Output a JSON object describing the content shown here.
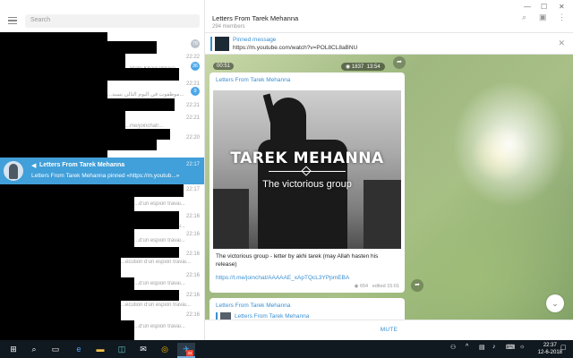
{
  "sidebar": {
    "search_placeholder": "Search",
    "rows": [
      {
        "time": "",
        "preview": "...",
        "badge": "78",
        "badge_color": "gray"
      },
      {
        "time": "22:22",
        "preview": "...",
        "badge": "36",
        "badge_color": "blue"
      },
      {
        "time": "22:21",
        "preview": "...State Khayr Wilaya...",
        "badge": "",
        "badge_color": ""
      },
      {
        "time": "22:21",
        "preview": "...",
        "badge": "9",
        "badge_color": "blue"
      },
      {
        "time": "22:21",
        "preview": "...موظفوت في اليوم التالي بسبد...",
        "badge": "",
        "badge_color": ""
      },
      {
        "time": "22:21",
        "preview": "...me/joinchat/...",
        "badge": "",
        "badge_color": ""
      },
      {
        "time": "22:20",
        "preview": "...",
        "badge": "",
        "badge_color": ""
      }
    ],
    "active_chat": {
      "title": "Letters From Tarek Mehanna",
      "time": "22:17",
      "preview": "Letters From Tarek Mehanna pinned «https://m.youtub...»"
    },
    "rows_after": [
      {
        "time": "22:17",
        "preview": "...",
        "badge": ""
      },
      {
        "time": "22:16",
        "preview": "...d'un espion travai...",
        "badge": ""
      },
      {
        "time": "22:16",
        "preview": "...d'un espion travai...",
        "badge": ""
      },
      {
        "time": "22:16",
        "preview": "...d'un espion travai...",
        "badge": ""
      },
      {
        "time": "22:16",
        "preview": "...écution d'un espion travai...",
        "badge": ""
      },
      {
        "time": "22:16",
        "preview": "...d'un espion travai...",
        "badge": ""
      },
      {
        "time": "22:16",
        "preview": "...écution d'un espion travai...",
        "badge": ""
      },
      {
        "time": "22:16",
        "preview": "...d'un espion travai...",
        "badge": ""
      }
    ]
  },
  "header": {
    "title": "Letters From Tarek Mehanna",
    "members": "294 members"
  },
  "pinned": {
    "label": "Pinned message",
    "text": "https://m.youtube.com/watch?v=POL8CL8aBNU"
  },
  "media_top": {
    "duration": "00:51",
    "views": "1837",
    "time": "13:54"
  },
  "message": {
    "author": "Letters From Tarek Mehanna",
    "photo_title": "TAREK MEHANNA",
    "photo_subtitle": "The victorious group",
    "text": "The victorious group - letter by akhi tarek (may Allah hasten his release)",
    "link": "https://t.me/joinchat/AAAAAE_xApTQcL3YPpmEBA",
    "views": "654",
    "edited": "edited 15:01"
  },
  "message2": {
    "author": "Letters From Tarek Mehanna",
    "forward_author": "Letters From Tarek Mehanna"
  },
  "footer": {
    "mute_label": "MUTE"
  },
  "taskbar": {
    "notification_count": "34",
    "time": "22:37",
    "date": "12-6-2018"
  },
  "colors": {
    "accent": "#419fd9",
    "link": "#3a8fd1",
    "taskbar": "#101820"
  }
}
